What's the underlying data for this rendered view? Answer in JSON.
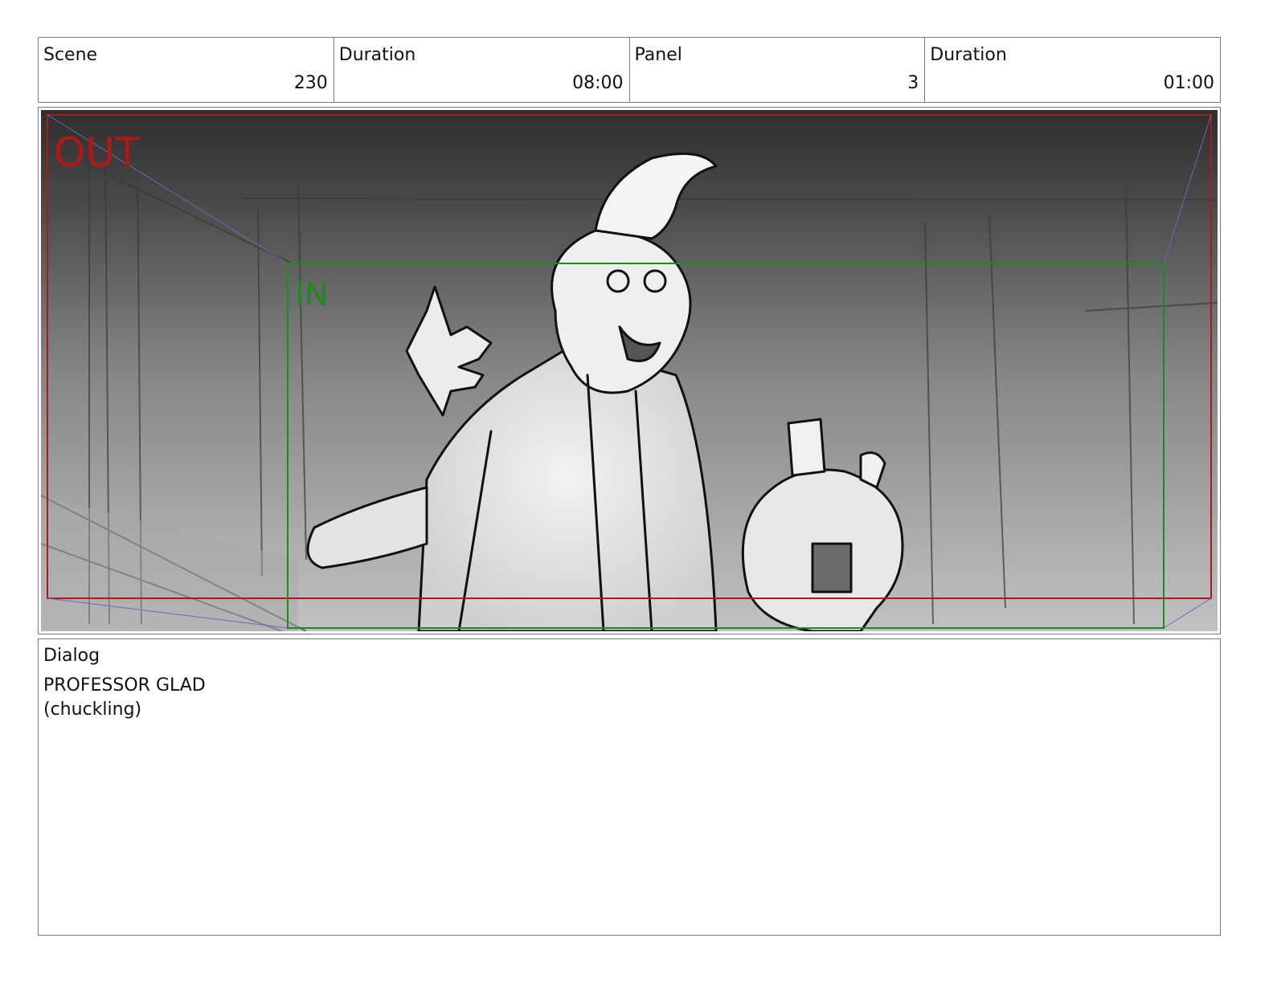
{
  "header": {
    "scene_label": "Scene",
    "scene_value": "230",
    "scene_duration_label": "Duration",
    "scene_duration_value": "08:00",
    "panel_label": "Panel",
    "panel_value": "3",
    "panel_duration_label": "Duration",
    "panel_duration_value": "01:00"
  },
  "frame": {
    "out_label": "OUT",
    "in_label": "IN",
    "out_color": "#b01818",
    "in_color": "#1f8a1f"
  },
  "dialog": {
    "label": "Dialog",
    "character": "PROFESSOR GLAD",
    "parenthetical": "(chuckling)"
  }
}
